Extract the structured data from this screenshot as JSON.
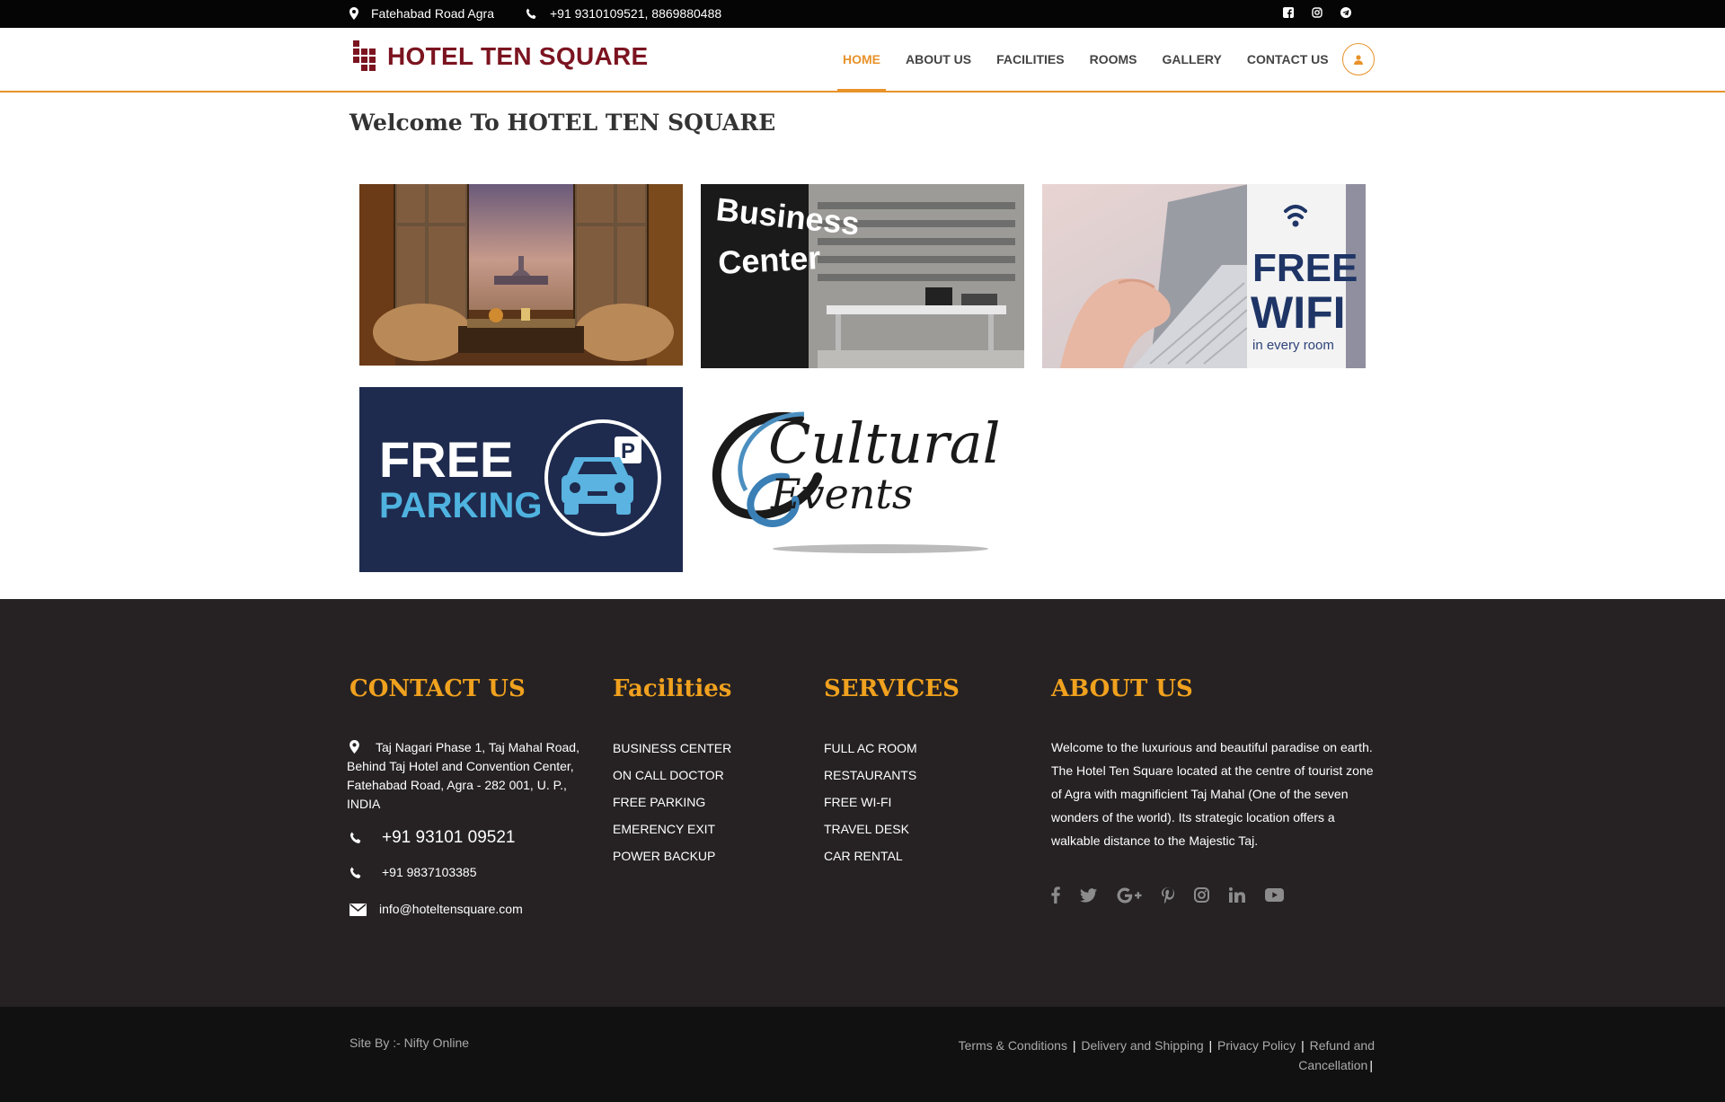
{
  "topbar": {
    "address": "Fatehabad Road Agra",
    "phones": "+91 9310109521, 8869880488",
    "social_icons": [
      "facebook-icon",
      "instagram-icon",
      "telegram-icon"
    ]
  },
  "header": {
    "brand": "HOTEL TEN SQUARE",
    "nav": [
      "HOME",
      "ABOUT US",
      "FACILITIES",
      "ROOMS",
      "GALLERY",
      "CONTACT US"
    ],
    "active_nav": "HOME"
  },
  "main": {
    "welcome": "Welcome To HOTEL TEN SQUARE",
    "tiles": {
      "business_line1": "Business",
      "business_line2": "Center",
      "wifi_line1": "FREE",
      "wifi_line2": "WIFI",
      "wifi_line3": "in every room",
      "parking_line1": "FREE",
      "parking_line2": "PARKING",
      "parking_sign": "P",
      "cultural_line1": "Cultural",
      "cultural_line2": "Events"
    }
  },
  "footer": {
    "contact": {
      "title": "CONTACT US",
      "address": "Taj Nagari Phase 1, Taj Mahal Road, Behind Taj Hotel and Convention Center, Fatehabad Road, Agra - 282 001, U. P., INDIA",
      "phone1": "+91 93101 09521",
      "phone2": "+91 9837103385",
      "email": "info@hoteltensquare.com"
    },
    "facilities": {
      "title": "Facilities",
      "items": [
        "BUSINESS CENTER",
        "ON CALL DOCTOR",
        "FREE PARKING",
        "EMERENCY EXIT",
        "POWER BACKUP"
      ]
    },
    "services": {
      "title": "SERVICES",
      "items": [
        "FULL AC ROOM",
        "RESTAURANTS",
        "FREE WI-FI",
        "TRAVEL DESK",
        "CAR RENTAL"
      ]
    },
    "about": {
      "title": "ABOUT US",
      "text": "Welcome to the luxurious and beautiful paradise on earth. The Hotel Ten Square located at the centre of tourist zone of Agra with magnificient Taj Mahal (One of the seven wonders of the world). Its strategic location offers a walkable distance to the Majestic Taj.",
      "social_icons": [
        "facebook-icon",
        "twitter-icon",
        "google-plus-icon",
        "pinterest-icon",
        "instagram-icon",
        "linkedin-icon",
        "youtube-icon"
      ]
    }
  },
  "bottom": {
    "site_by": "Site By :- Nifty Online",
    "links": [
      "Terms & Conditions",
      "Delivery and Shipping",
      "Privacy Policy",
      "Refund and Cancellation"
    ]
  },
  "colors": {
    "accent": "#e8922a",
    "brand": "#7b1420",
    "footer_bg": "#262223",
    "footer_title": "#f0a11e"
  }
}
